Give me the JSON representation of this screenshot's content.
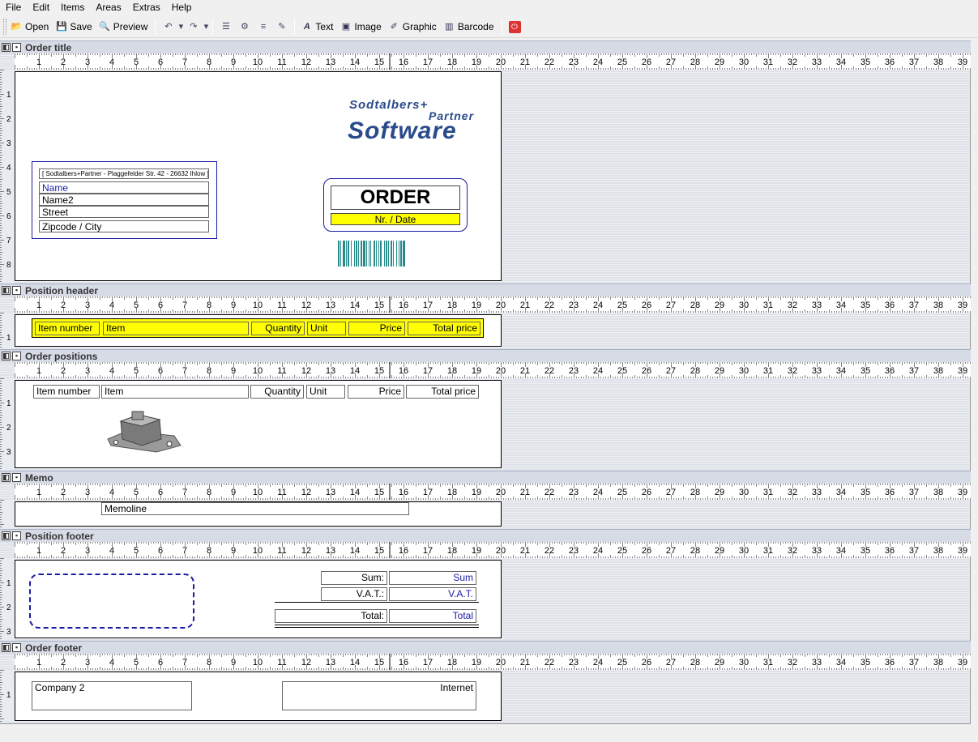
{
  "menu": [
    "File",
    "Edit",
    "Items",
    "Areas",
    "Extras",
    "Help"
  ],
  "toolbar": {
    "open": "Open",
    "save": "Save",
    "preview": "Preview",
    "text": "Text",
    "image": "Image",
    "graphic": "Graphic",
    "barcode": "Barcode"
  },
  "ruler_numbers": [
    "1",
    "2",
    "3",
    "4",
    "5",
    "6",
    "7",
    "8",
    "9",
    "10",
    "11",
    "12",
    "13",
    "14",
    "15",
    "16",
    "17",
    "18",
    "19",
    "20",
    "21",
    "22",
    "23",
    "24",
    "25",
    "26",
    "27",
    "28",
    "29",
    "30",
    "31",
    "32",
    "33",
    "34",
    "35",
    "36",
    "37",
    "38",
    "39"
  ],
  "sections": {
    "order_title": "Order title",
    "position_header": "Position header",
    "order_positions": "Order positions",
    "memo": "Memo",
    "position_footer": "Position footer",
    "order_footer": "Order footer"
  },
  "logo": {
    "line1": "Sodtalbers+",
    "line2": "Partner",
    "line3": "Software"
  },
  "address": {
    "sender": "[ Sodtalbers+Partner - Plaggefelder Str. 42 - 26632 Ihlow ]",
    "name": "Name",
    "name2": "Name2",
    "street": "Street",
    "zip_city": "Zipcode / City"
  },
  "order_box": {
    "title": "ORDER",
    "nr_date": "Nr. / Date"
  },
  "header_cols": [
    "Item number",
    "Item",
    "Quantity",
    "Unit",
    "Price",
    "Total price"
  ],
  "position_cols": [
    "Item number",
    "Item",
    "Quantity",
    "Unit",
    "Price",
    "Total price"
  ],
  "memo": {
    "line": "Memoline"
  },
  "totals": {
    "sum_label": "Sum:",
    "sum_value": "Sum",
    "vat_label": "V.A.T.:",
    "vat_value": "V.A.T.",
    "total_label": "Total:",
    "total_value": "Total"
  },
  "footer": {
    "company": "Company 2",
    "internet": "Internet"
  },
  "colors": {
    "highlight": "#ffff00",
    "field_text_blue": "#1a1aa6",
    "barcode": "#2a8a8a",
    "logo": "#2a4b8a"
  }
}
